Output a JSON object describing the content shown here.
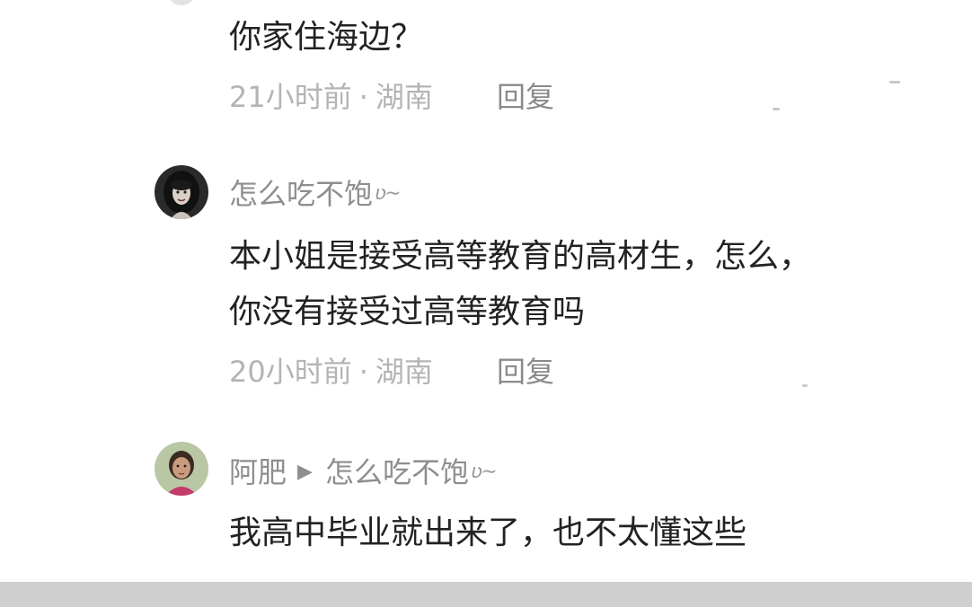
{
  "comments": [
    {
      "text": "你家住海边？",
      "time": "21小时前",
      "location": "湖南",
      "reply_label": "回复"
    },
    {
      "username": "怎么吃不饱",
      "badge": "ʋ∼",
      "text_line1": "本小姐是接受高等教育的高材生，怎么，",
      "text_line2": "你没有接受过高等教育吗",
      "time": "20小时前",
      "location": "湖南",
      "reply_label": "回复"
    },
    {
      "username": "阿肥",
      "reply_arrow": "▶",
      "reply_to": "怎么吃不饱",
      "badge": "ʋ∼",
      "text": "我高中毕业就出来了，也不太懂这些"
    }
  ],
  "meta_separator": "·",
  "colors": {
    "text": "#222222",
    "username": "#8e8e8e",
    "meta": "#b4b4b4",
    "background": "#ffffff"
  },
  "icons": {
    "avatar_1": "woman-dark-hair-avatar",
    "avatar_2": "woman-photo-avatar",
    "reply_arrow": "triangle-right-icon"
  }
}
